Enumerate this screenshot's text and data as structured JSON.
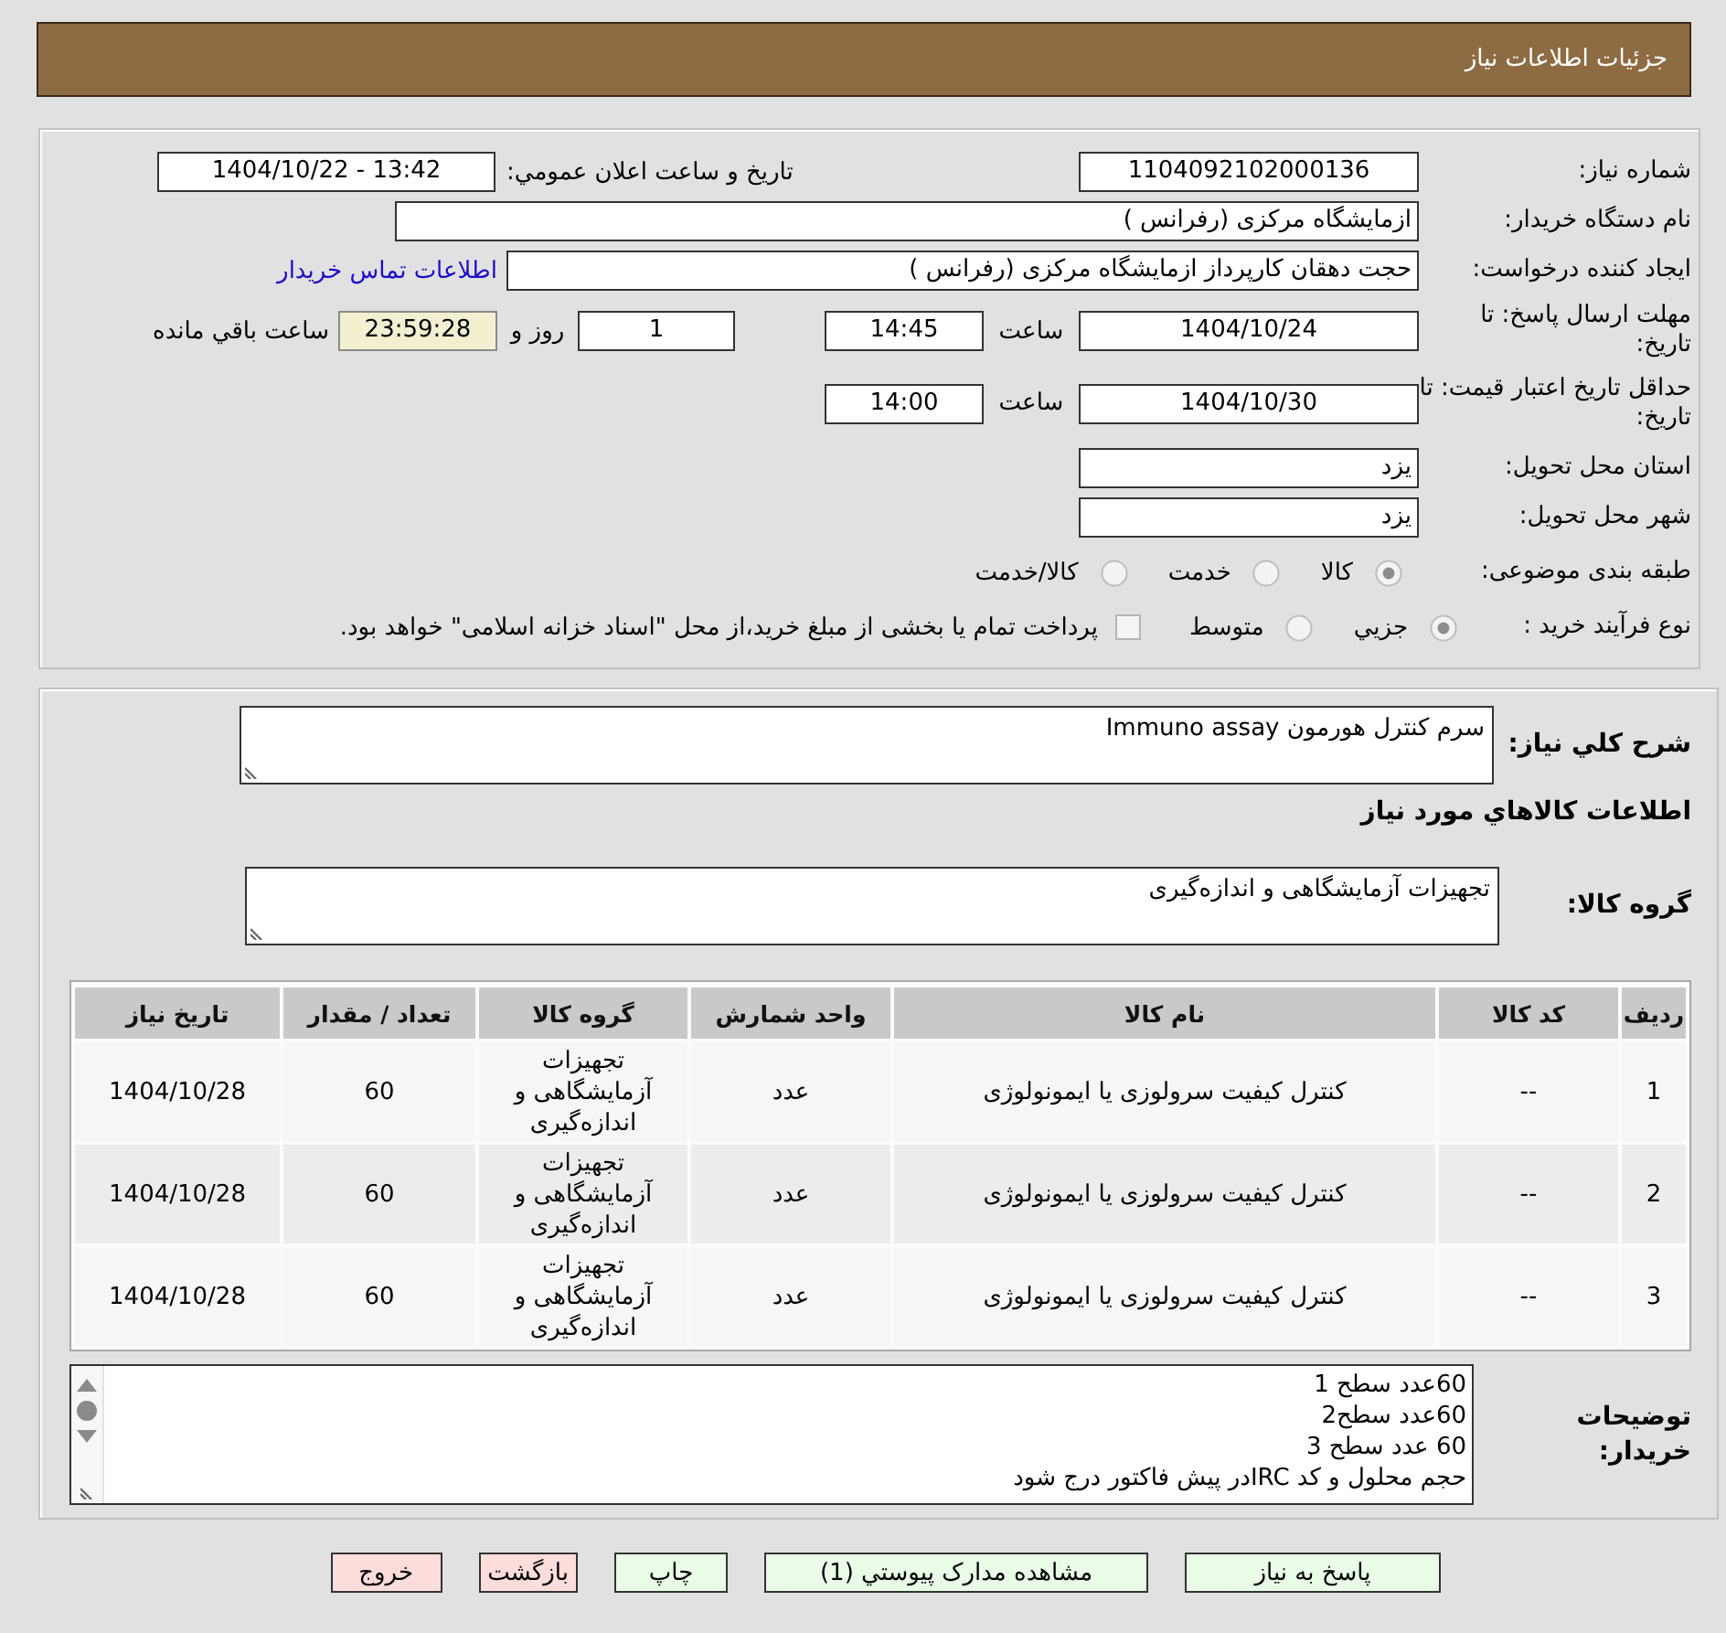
{
  "header": {
    "title": "جزئیات اطلاعات نیاز"
  },
  "details": {
    "need_number": {
      "label": "شماره نیاز:",
      "value": "1104092102000136"
    },
    "announcement": {
      "label": "تاریخ و ساعت اعلان عمومي:",
      "value": "1404/10/22 - 13:42"
    },
    "buyer_org": {
      "label": "نام دستگاه خریدار:",
      "value": "ازمایشگاه مرکزی (رفرانس )"
    },
    "requester": {
      "label": "ایجاد کننده درخواست:",
      "value": "حجت دهقان کارپرداز ازمایشگاه مرکزی (رفرانس )",
      "contact_link": "اطلاعات تماس خریدار"
    },
    "response_deadline": {
      "label": "مهلت ارسال پاسخ: تا تاریخ:",
      "date": "1404/10/24",
      "time_label": "ساعت",
      "time": "14:45",
      "days": "1",
      "days_label": "روز و",
      "remaining": "23:59:28",
      "remaining_label": "ساعت باقي مانده"
    },
    "price_validity": {
      "label": "حداقل تاریخ اعتبار قیمت: تا تاریخ:",
      "date": "1404/10/30",
      "time_label": "ساعت",
      "time": "14:00"
    },
    "delivery_province": {
      "label": "استان محل تحویل:",
      "value": "یزد"
    },
    "delivery_city": {
      "label": "شهر محل تحویل:",
      "value": "یزد"
    },
    "subject_category": {
      "label": "طبقه بندی موضوعی:",
      "options": [
        {
          "label": "کالا",
          "selected": true
        },
        {
          "label": "خدمت",
          "selected": false
        },
        {
          "label": "کالا/خدمت",
          "selected": false
        }
      ]
    },
    "purchase_process": {
      "label": "نوع فرآیند خرید :",
      "options": [
        {
          "label": "جزيي",
          "selected": true
        },
        {
          "label": "متوسط",
          "selected": false
        }
      ],
      "treasury_payment": {
        "label": "پرداخت تمام یا بخشی از مبلغ خرید،از محل \"اسناد خزانه اسلامی\" خواهد بود.",
        "checked": false
      }
    }
  },
  "goods": {
    "description": {
      "label": "شرح کلي نیاز:",
      "value": "سرم کنترل هورمون Immuno assay"
    },
    "section_title": "اطلاعات کالاهاي مورد نیاز",
    "goods_group": {
      "label": "گروه کالا:",
      "value": "تجهیزات آزمایشگاهی و اندازه‌گیری"
    },
    "table": {
      "columns": [
        "ردیف",
        "کد کالا",
        "نام کالا",
        "واحد شمارش",
        "گروه کالا",
        "تعداد / مقدار",
        "تاریخ نیاز"
      ],
      "rows": [
        [
          "1",
          "--",
          "کنترل کیفیت سرولوزی یا ایمونولوژی",
          "عدد",
          "تجهیزات آزمایشگاهی و اندازه‌گیری",
          "60",
          "1404/10/28"
        ],
        [
          "2",
          "--",
          "کنترل کیفیت سرولوزی یا ایمونولوژی",
          "عدد",
          "تجهیزات آزمایشگاهی و اندازه‌گیری",
          "60",
          "1404/10/28"
        ],
        [
          "3",
          "--",
          "کنترل کیفیت سرولوزی یا ایمونولوژی",
          "عدد",
          "تجهیزات آزمایشگاهی و اندازه‌گیری",
          "60",
          "1404/10/28"
        ]
      ]
    },
    "buyer_notes": {
      "label": "توضیحات خریدار:",
      "lines": [
        "60عدد سطح 1",
        "60عدد سطح2",
        "60 عدد سطح 3",
        "حجم محلول و کد IRCدر پیش فاکتور درج شود"
      ]
    }
  },
  "buttons": [
    {
      "label": "پاسخ به نیاز",
      "color": "#eafbe8"
    },
    {
      "label": "مشاهده مدارک پیوستي (1)",
      "color": "#eafbe8"
    },
    {
      "label": "چاپ",
      "color": "#eafbe8"
    },
    {
      "label": "بازگشت",
      "color": "#fddcdc"
    },
    {
      "label": "خروج",
      "color": "#fddcdc"
    }
  ]
}
